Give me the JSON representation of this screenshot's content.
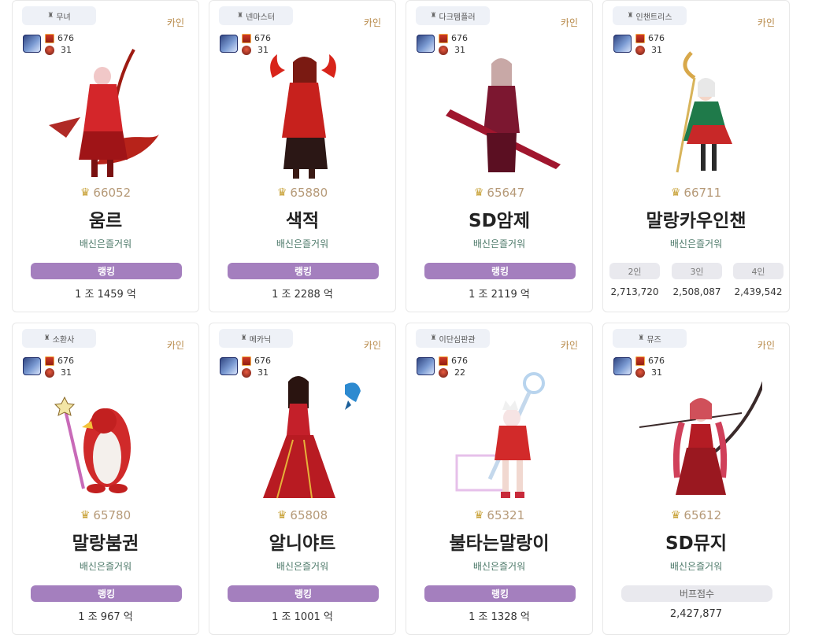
{
  "cards": [
    {
      "job": "무녀",
      "server": "카인",
      "fame": "676",
      "level": "31",
      "score": "66052",
      "name": "움르",
      "guild": "배신은즐거워",
      "button": "랭킹",
      "total": "1 조 1459 억"
    },
    {
      "job": "넨마스터",
      "server": "카인",
      "fame": "676",
      "level": "31",
      "score": "65880",
      "name": "색적",
      "guild": "배신은즐거워",
      "button": "랭킹",
      "total": "1 조 2288 억"
    },
    {
      "job": "다크템플러",
      "server": "카인",
      "fame": "676",
      "level": "31",
      "score": "65647",
      "name": "SD암제",
      "guild": "배신은즐거워",
      "button": "랭킹",
      "total": "1 조 2119 억"
    },
    {
      "job": "인챈트리스",
      "server": "카인",
      "fame": "676",
      "level": "31",
      "score": "66711",
      "name": "말랑카우인챈",
      "guild": "배신은즐거워",
      "buffs": [
        {
          "label": "2인",
          "value": "2,713,720"
        },
        {
          "label": "3인",
          "value": "2,508,087"
        },
        {
          "label": "4인",
          "value": "2,439,542"
        }
      ]
    },
    {
      "job": "소환사",
      "server": "카인",
      "fame": "676",
      "level": "31",
      "score": "65780",
      "name": "말랑붐권",
      "guild": "배신은즐거워",
      "button": "랭킹",
      "total": "1 조 967 억"
    },
    {
      "job": "메카닉",
      "server": "카인",
      "fame": "676",
      "level": "31",
      "score": "65808",
      "name": "알니야트",
      "guild": "배신은즐거워",
      "button": "랭킹",
      "total": "1 조 1001 억"
    },
    {
      "job": "이단심판관",
      "server": "카인",
      "fame": "676",
      "level": "22",
      "score": "65321",
      "name": "불타는말랑이",
      "guild": "배신은즐거워",
      "button": "랭킹",
      "total": "1 조 1328 억"
    },
    {
      "job": "뮤즈",
      "server": "카인",
      "fame": "676",
      "level": "31",
      "score": "65612",
      "name": "SD뮤지",
      "guild": "배신은즐거워",
      "buff_label": "버프점수",
      "buff_value": "2,427,877"
    }
  ],
  "colors": {
    "rank_button": "#a47fbe",
    "server": "#b88a4a",
    "guild": "#4e7a6a",
    "score": "#b69a78"
  }
}
